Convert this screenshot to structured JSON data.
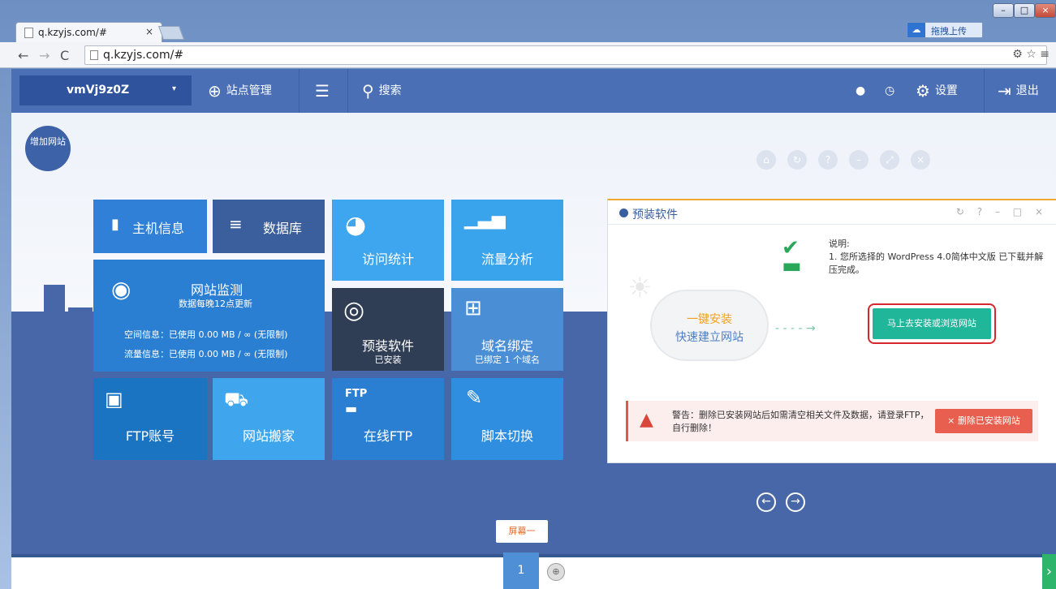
{
  "browser": {
    "tab_title": "q.kzyjs.com/#",
    "tab_close": "×",
    "url": "q.kzyjs.com/#",
    "upload_label": "拖拽上传",
    "window_buttons": [
      "–",
      "□",
      "×"
    ],
    "addr_right_icons": "⚙ ☆ ≡"
  },
  "topbar": {
    "site_name": "vmVj9z0Z",
    "site_caret": "▾",
    "site_manage": "站点管理",
    "search": "搜索",
    "settings": "设置",
    "logout": "退出"
  },
  "stage": {
    "add_site": "增加网站",
    "controls": [
      "⌂",
      "↻",
      "?",
      "–",
      "⤢",
      "×"
    ]
  },
  "tiles": {
    "host_info": "主机信息",
    "database": "数据库",
    "visit_stats": "访问统计",
    "traffic_analysis": "流量分析",
    "site_monitor": "网站监测",
    "site_monitor_sub": "数据每晚12点更新",
    "space_info": "空间信息：已使用 0.00 MB / ∞ (无限制)",
    "traffic_info": "流量信息：已使用 0.00 MB / ∞ (无限制)",
    "preinstall": "预装软件",
    "preinstall_sub": "已安装",
    "domain_bind": "域名绑定",
    "domain_bind_sub": "已绑定 1 个域名",
    "ftp_account": "FTP账号",
    "site_move": "网站搬家",
    "online_ftp": "在线FTP",
    "ftp_icon_label": "FTP",
    "script_switch": "脚本切换"
  },
  "widget": {
    "title": "预装软件",
    "header_ops": "↻ ? – □ ×",
    "cloud_line1": "一键安装",
    "cloud_line2": "快速建立网站",
    "note_title": "说明:",
    "note_body": "1. 您所选择的 WordPress 4.0简体中文版 已下载并解压完成。",
    "install_button": "马上去安装或浏览网站",
    "warning": "警告：删除已安装网站后如需清空相关文件及数据，请登录FTP，自行删除！",
    "delete_button": "删除已安装网站",
    "delete_x": "×"
  },
  "pager": {
    "screen_label": "屏幕一",
    "screen_number": "1",
    "prev": "←",
    "next": "→"
  },
  "colors": {
    "topbar": "#4a6fb5",
    "tile_blue": "#2b7fd2",
    "tile_light": "#3fa6ee",
    "tile_dark": "#2f3e55",
    "install_green": "#1fb69a",
    "warn_red": "#e85e4f"
  }
}
